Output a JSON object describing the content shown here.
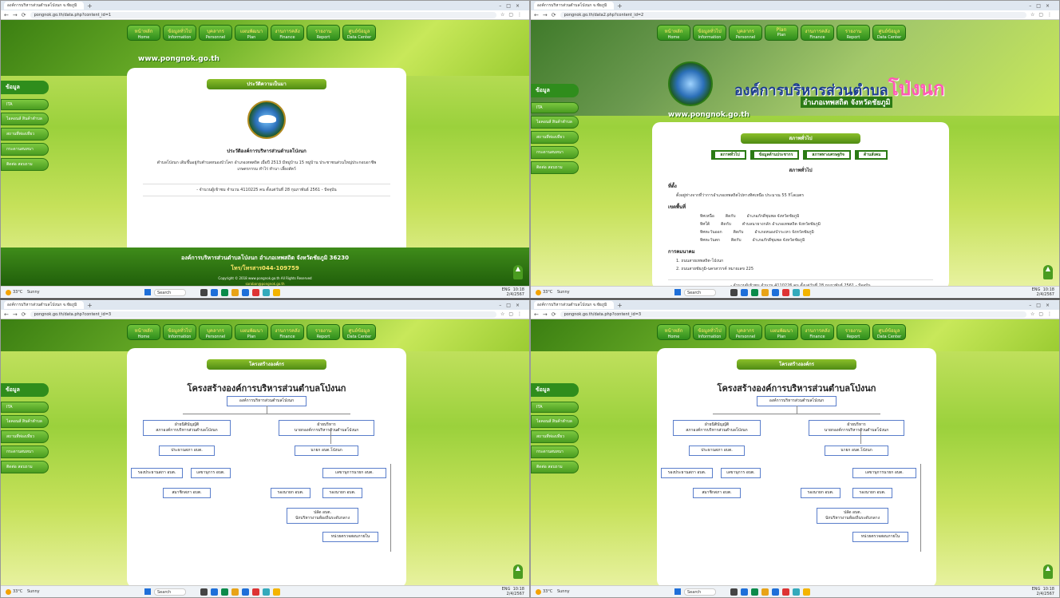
{
  "q1": {
    "browser_tab": "องค์การบริหารส่วนตำบลโป่งนก จ.ชัยภูมิ",
    "url": "pongnok.go.th/data.php?content_id=1",
    "menu": [
      {
        "th": "หน้าหลัก",
        "en": "Home"
      },
      {
        "th": "ข้อมูลทั่วไป",
        "en": "Information"
      },
      {
        "th": "บุคลากร",
        "en": "Personnel"
      },
      {
        "th": "แผนพัฒนา",
        "en": "Plan"
      },
      {
        "th": "งานการคลัง",
        "en": "Finance"
      },
      {
        "th": "รายงาน",
        "en": "Report"
      },
      {
        "th": "ศูนย์ข้อมูล",
        "en": "Data Center"
      }
    ],
    "site": "www.pongnok.go.th",
    "sidebar_head": "ข้อมูล",
    "sidebar_items": [
      "ITA",
      "ไอคอนส์ สินค้าตำบล",
      "สถานที่ท่องเที่ยว",
      "กระดานสนทนา",
      "ติดต่อ สอบถาม"
    ],
    "content_title": "ประวัติความเป็นมา",
    "heading": "ประวัติองค์การบริหารส่วนตำบลโป่งนก",
    "paragraph": "ตำบลโป่งนก เดิมขึ้นอยู่กับตำบลหนองบัวโคก อำเภอเทพสถิต เมื่อปี 2513 มีหมู่บ้าน 15 หมู่บ้าน ประชาชนส่วนใหญ่ประกอบอาชีพเกษตรกรรม ทำไร่ ทำนา เลี้ยงสัตว์",
    "counter": "- จำนวนผู้เข้าชม จำนวน 4110225 คน ตั้งแต่วันที่ 28 กุมภาพันธ์ 2561 - ปัจจุบัน",
    "footer1": "องค์การบริหารส่วนตำบลโป่งนก อำเภอเทพสถิต จังหวัดชัยภูมิ 36230",
    "footer2": "โทร/โทรสาร044-109759",
    "footer3": "Copyright © 2018 www.pongnok.go.th All Rights Reserved",
    "footer4": "saraban@pongnok.go.th"
  },
  "q2": {
    "browser_tab": "องค์การบริหารส่วนตำบลโป่งนก จ.ชัยภูมิ",
    "url": "pongnok.go.th/data2.php?content_id=2",
    "menu_plan": "Plan",
    "big_title_a": "องค์การบริหารส่วนตำบล",
    "big_title_b": "โป่งนก",
    "subtitle": "อำเภอเทพสถิต จังหวัดชัยภูมิ",
    "content_title": "สภาพทั่วไป",
    "tabs": [
      "สภาพทั่วไป",
      "ข้อมูลด้านประชากร",
      "สภาพทางเศรษฐกิจ",
      "ด้านสังคม"
    ],
    "h_general": "สภาพทั่วไป",
    "s_location": "ที่ตั้ง",
    "location": "ตั้งอยู่ห่างจากที่ว่าการอำเภอเทพสถิตไปทางทิศเหนือ ประมาณ 55 กิโลเมตร",
    "s_border": "เขตพื้นที่",
    "borders": [
      [
        "ทิศเหนือ",
        "ติดกับ",
        "อำเภอภักดีชุมพล จังหวัดชัยภูมิ"
      ],
      [
        "ทิศใต้",
        "ติดกับ",
        "ตำบลนายางกลัก อำเภอเทพสถิต จังหวัดชัยภูมิ"
      ],
      [
        "ทิศตะวันออก",
        "ติดกับ",
        "อำเภอหนองบัวระเหว จังหวัดชัยภูมิ"
      ],
      [
        "ทิศตะวันตก",
        "ติดกับ",
        "อำเภอภักดีชุมพล จังหวัดชัยภูมิ"
      ]
    ],
    "s_transport": "การคมนาคม",
    "transport": [
      "1. ถนนสายเทพสถิต-โป่งนก",
      "2. ถนนสายชัยภูมิ-นครสวรรค์ หมายเลข 225"
    ],
    "counter": "- จำนวนผู้เข้าชม จำนวน 4110226 คน ตั้งแต่วันที่ 28 กุมภาพันธ์ 2561 - ปัจจุบัน"
  },
  "q3": {
    "url": "pongnok.go.th/data.php?content_id=3",
    "content_title": "โครงสร้างองค์กร",
    "org_title": "โครงสร้างองค์การบริหารส่วนตำบลโป่งนก",
    "top": "องค์การบริหารส่วนตำบลโป่งนก",
    "legis": "ฝ่ายนิติบัญญัติ\nสภาองค์การบริหารส่วนตำบลโป่งนก",
    "exec": "ฝ่ายบริหาร\nนายกองค์การบริหารส่วนตำบลโป่งนก",
    "council_chair": "ประธานสภา อบต.",
    "vice_chair": "รองประธานสภา อบต.",
    "secretary": "เลขานุการ อบต.",
    "members": "สมาชิกสภา อบต.",
    "mayor": "นายก อบต.โป่งนก",
    "mayor_sec": "เลขานุการนายก อบต.",
    "deputy1": "รองนายก อบต.",
    "deputy2": "รองนายก อบต.",
    "clerk": "ปลัด อบต.\nนักบริหารงานท้องถิ่นระดับกลาง",
    "audit": "หน่วยตรวจสอบภายใน"
  },
  "taskbar": {
    "temp": "33°C",
    "weather": "Sunny",
    "search": "Search",
    "lang": "ENG",
    "time": "10:18",
    "date": "2/4/2567"
  }
}
